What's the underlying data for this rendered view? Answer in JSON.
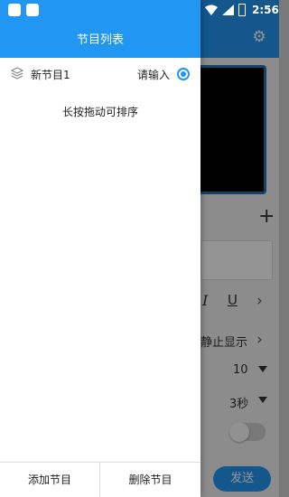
{
  "status_bar": {
    "time": "2:56"
  },
  "drawer": {
    "title": "节目列表",
    "programs": [
      {
        "name": "新节目1",
        "hint": "请输入",
        "selected": true
      }
    ],
    "drag_hint": "长按拖动可排序",
    "footer": {
      "add_label": "添加节目",
      "delete_label": "删除节目"
    }
  },
  "background": {
    "italic_label": "I",
    "underline_label": "U",
    "display_mode": "静止显示",
    "font_size": "10",
    "speed": "3秒",
    "send_label": "发送"
  },
  "colors": {
    "accent": "#2196f3"
  }
}
